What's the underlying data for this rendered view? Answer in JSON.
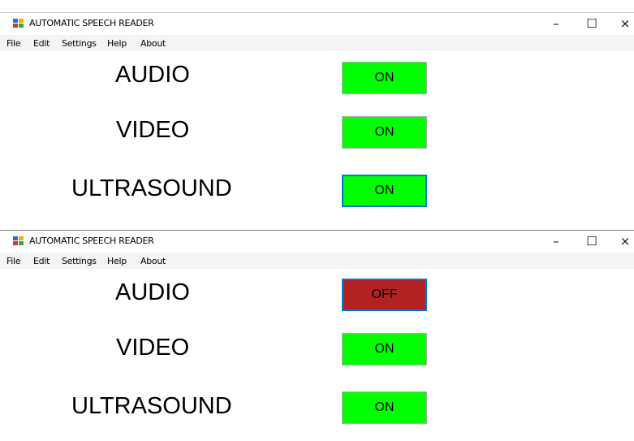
{
  "windows": [
    {
      "title": "AUTOMATIC SPEECH READER",
      "controls": {
        "minimize": "–",
        "maximize": "☐",
        "close": "×"
      },
      "menu": [
        "File",
        "Edit",
        "Settings",
        "Help",
        "About"
      ],
      "rows": [
        {
          "label": "AUDIO",
          "state": "ON",
          "state_color": "#00ff00",
          "focused": false
        },
        {
          "label": "VIDEO",
          "state": "ON",
          "state_color": "#00ff00",
          "focused": false
        },
        {
          "label": "ULTRASOUND",
          "state": "ON",
          "state_color": "#00ff00",
          "focused": true
        }
      ]
    },
    {
      "title": "AUTOMATIC SPEECH READER",
      "controls": {
        "minimize": "–",
        "maximize": "☐",
        "close": "×"
      },
      "menu": [
        "File",
        "Edit",
        "Settings",
        "Help",
        "About"
      ],
      "rows": [
        {
          "label": "AUDIO",
          "state": "OFF",
          "state_color": "#b22222",
          "focused": true
        },
        {
          "label": "VIDEO",
          "state": "ON",
          "state_color": "#00ff00",
          "focused": false
        },
        {
          "label": "ULTRASOUND",
          "state": "ON",
          "state_color": "#00ff00",
          "focused": false
        }
      ]
    }
  ]
}
